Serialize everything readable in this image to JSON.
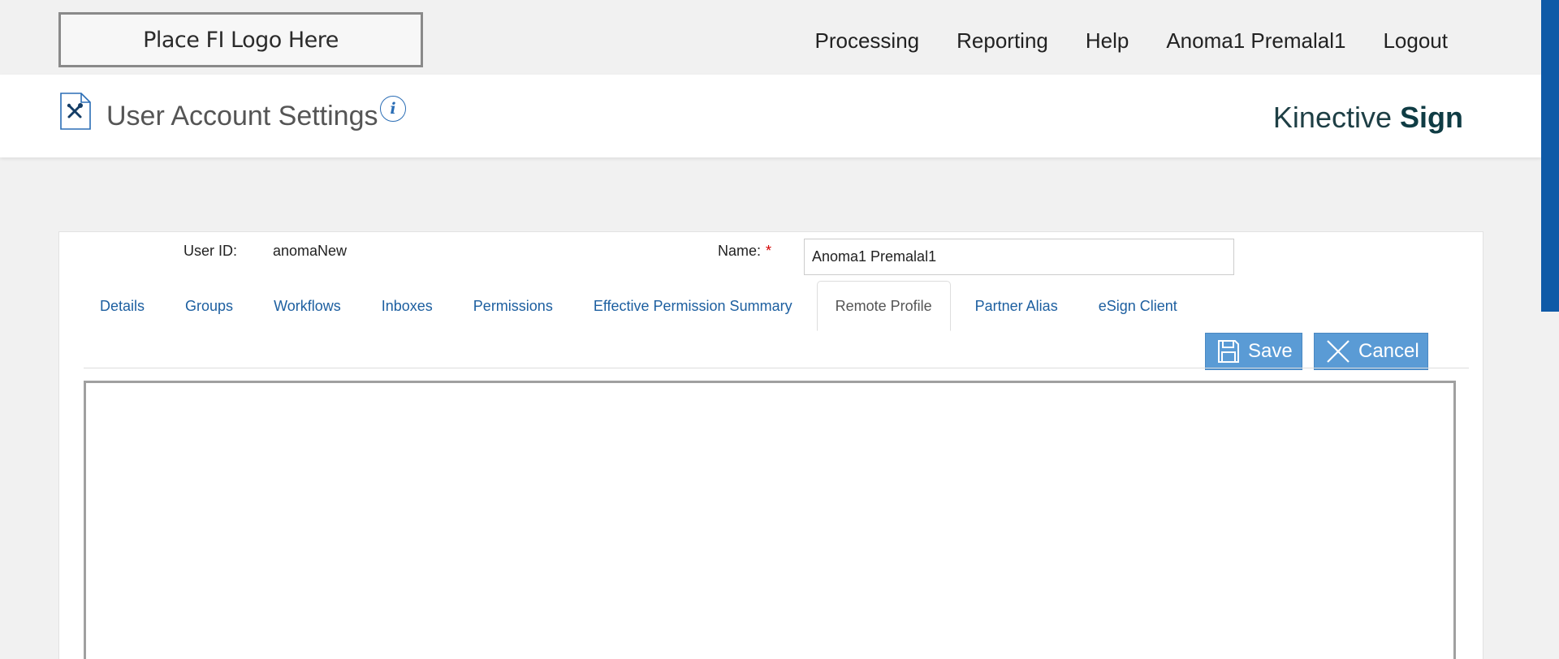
{
  "logo": {
    "text": "Place FI Logo Here"
  },
  "nav": {
    "items": [
      "Processing",
      "Reporting",
      "Help",
      "Anoma1 Premalal1",
      "Logout"
    ]
  },
  "header": {
    "title": "User Account Settings",
    "info_icon_glyph": "i",
    "brand_light": "Kinective ",
    "brand_bold": "Sign"
  },
  "form": {
    "user_id_label": "User ID:",
    "user_id_value": "anomaNew",
    "name_label": "Name:",
    "required_marker": "*",
    "name_value": "Anoma1 Premalal1"
  },
  "tabs": [
    {
      "label": "Details",
      "active": false
    },
    {
      "label": "Groups",
      "active": false
    },
    {
      "label": "Workflows",
      "active": false
    },
    {
      "label": "Inboxes",
      "active": false
    },
    {
      "label": "Permissions",
      "active": false
    },
    {
      "label": "Effective Permission Summary",
      "active": false
    },
    {
      "label": "Remote Profile",
      "active": true
    },
    {
      "label": "Partner Alias",
      "active": false
    },
    {
      "label": "eSign Client",
      "active": false
    }
  ],
  "actions": {
    "save_label": "Save",
    "cancel_label": "Cancel"
  },
  "colors": {
    "link_blue": "#1d5fa0",
    "button_blue": "#5a9bd5",
    "accent_blue": "#0f5aa7",
    "required_red": "#d40000"
  },
  "icons": {
    "page": "settings-document-icon",
    "info": "info-icon",
    "save": "floppy-disk-icon",
    "cancel": "close-icon"
  }
}
